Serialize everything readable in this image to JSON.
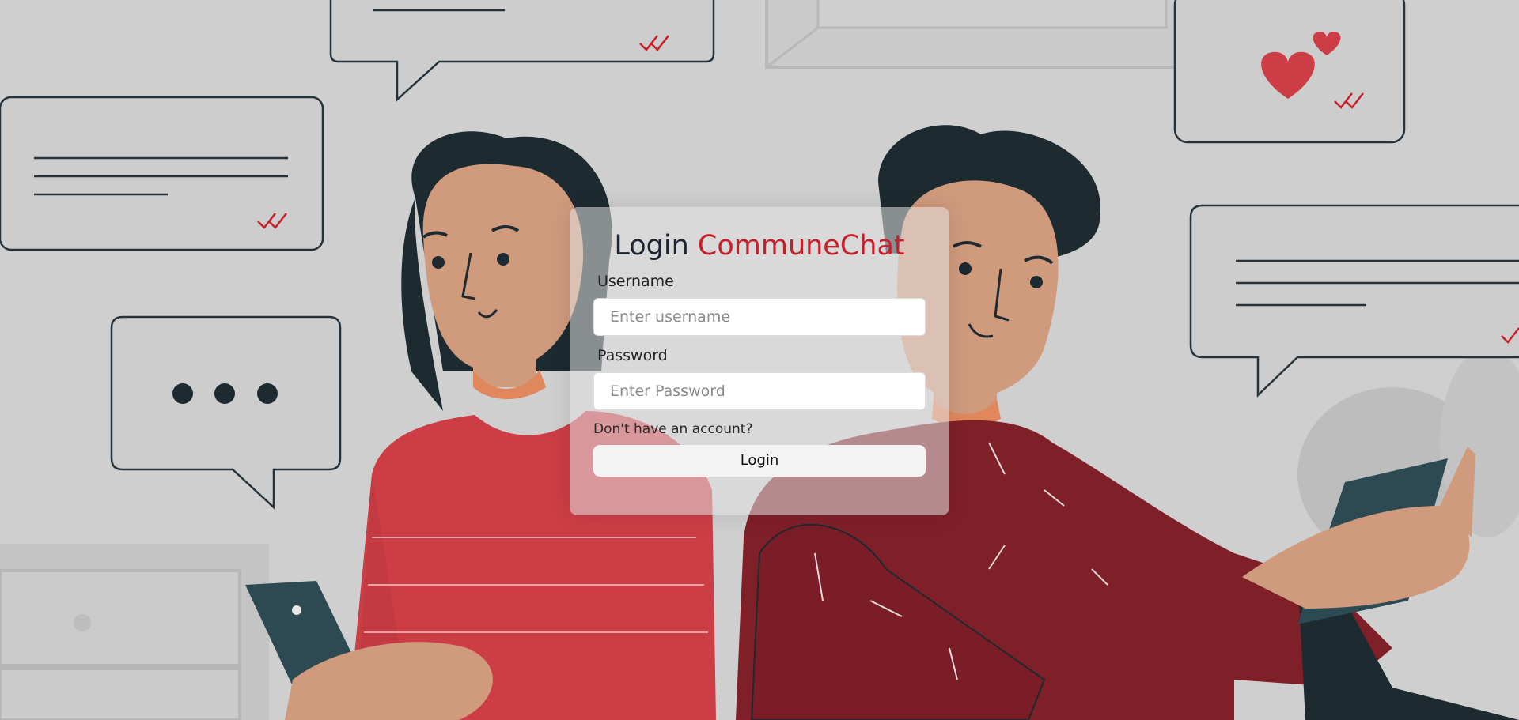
{
  "login": {
    "title_prefix": "Login",
    "brand": "CommuneChat",
    "username_label": "Username",
    "username_placeholder": "Enter username",
    "password_label": "Password",
    "password_placeholder": "Enter Password",
    "signup_link": "Don't have an account?",
    "submit_label": "Login"
  },
  "theme": {
    "brand_color": "#c61f2a",
    "background": "#cfcfcf",
    "shirt_left": "#cc3d45",
    "shirt_right": "#7f1f28",
    "skin": "#d09a7c",
    "hair": "#1d2a30"
  }
}
